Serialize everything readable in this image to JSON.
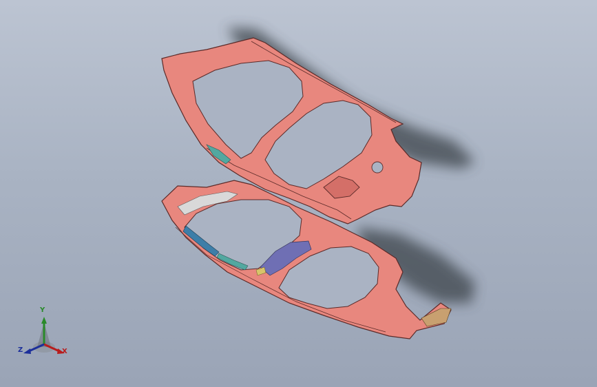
{
  "viewport": {
    "background_top": "#bcc4d2",
    "background_bottom": "#9aa4b6"
  },
  "model": {
    "body_color": "#e8877e",
    "edge_color": "#5a2a28",
    "shadow_color": "#3e444c",
    "detail_colors": [
      "#3d7ea8",
      "#52a8a0",
      "#6f6fb4",
      "#d8c46a",
      "#c8a070",
      "#d9d9d9"
    ]
  },
  "triad": {
    "x_label": "X",
    "y_label": "Y",
    "z_label": "Z",
    "x_color": "#b81c1c",
    "y_color": "#2a8a2a",
    "z_color": "#1c2f9a"
  }
}
